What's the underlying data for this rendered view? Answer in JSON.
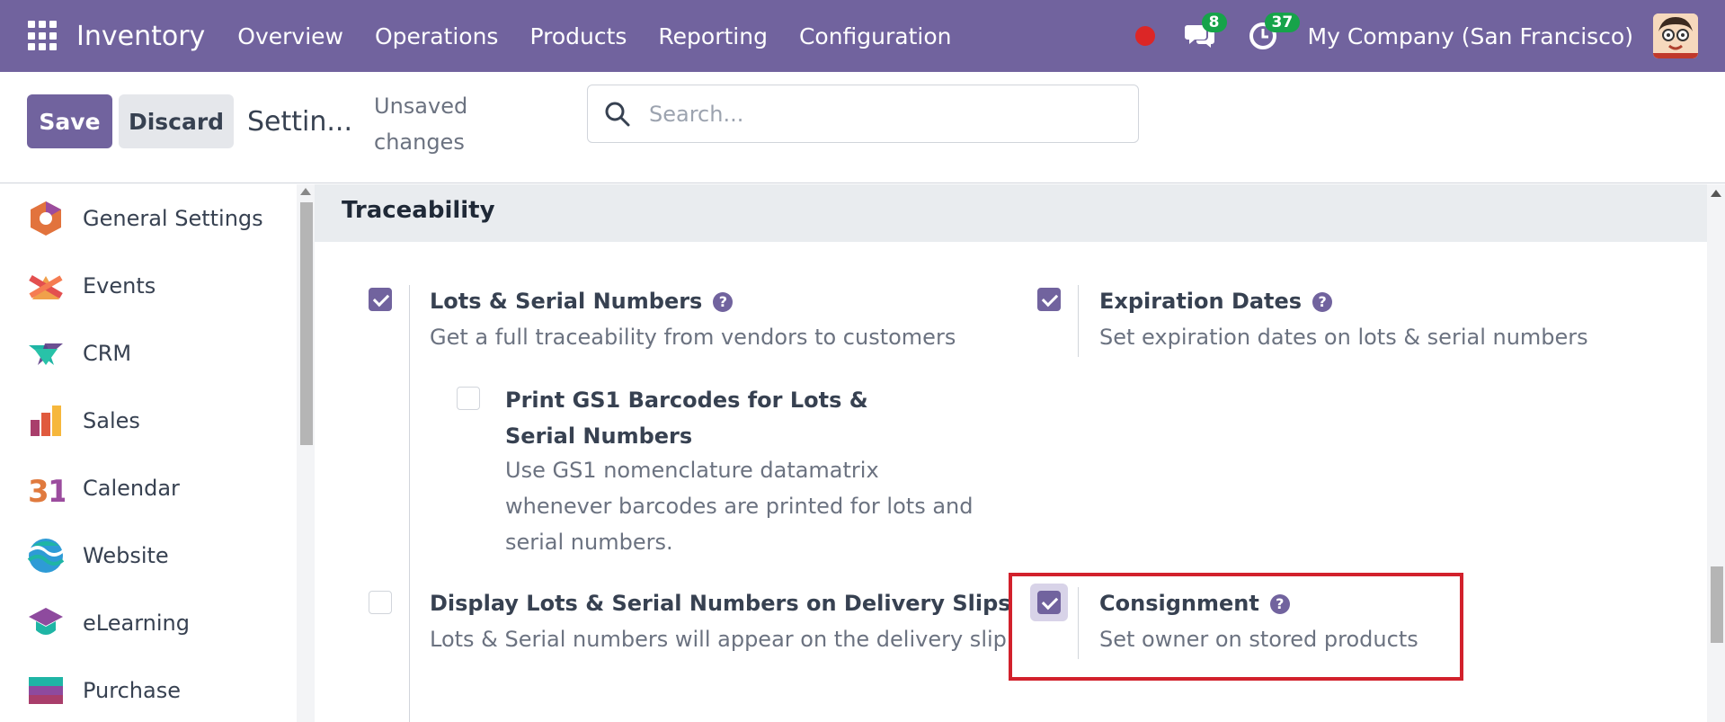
{
  "navbar": {
    "brand": "Inventory",
    "menu": [
      "Overview",
      "Operations",
      "Products",
      "Reporting",
      "Configuration"
    ],
    "messages_count": "8",
    "activities_count": "37",
    "company": "My Company (San Francisco)"
  },
  "control": {
    "save_label": "Save",
    "discard_label": "Discard",
    "breadcrumb": "Settin...",
    "unsaved": "Unsaved changes",
    "search_placeholder": "Search..."
  },
  "sidebar": {
    "items": [
      {
        "label": "General Settings",
        "icon": "general-settings-icon"
      },
      {
        "label": "Events",
        "icon": "events-icon"
      },
      {
        "label": "CRM",
        "icon": "crm-icon"
      },
      {
        "label": "Sales",
        "icon": "sales-icon"
      },
      {
        "label": "Calendar",
        "icon": "calendar-icon"
      },
      {
        "label": "Website",
        "icon": "website-icon"
      },
      {
        "label": "eLearning",
        "icon": "elearning-icon"
      },
      {
        "label": "Purchase",
        "icon": "purchase-icon"
      }
    ]
  },
  "section": {
    "title": "Traceability",
    "settings": {
      "lots": {
        "title": "Lots & Serial Numbers",
        "desc": "Get a full traceability from vendors to customers",
        "checked": true
      },
      "gs1": {
        "title": "Print GS1 Barcodes for Lots & Serial Numbers",
        "desc": "Use GS1 nomenclature datamatrix whenever barcodes are printed for lots and serial numbers.",
        "checked": false
      },
      "display_lots": {
        "title": "Display Lots & Serial Numbers on Delivery Slips",
        "desc": "Lots & Serial numbers will appear on the delivery slip",
        "checked": false
      },
      "expiration": {
        "title": "Expiration Dates",
        "desc": "Set expiration dates on lots & serial numbers",
        "checked": true
      },
      "consignment": {
        "title": "Consignment",
        "desc": "Set owner on stored products",
        "checked": true
      }
    }
  },
  "colors": {
    "brand": "#71639e",
    "highlight": "#d2212c",
    "badge": "#16a34a"
  }
}
